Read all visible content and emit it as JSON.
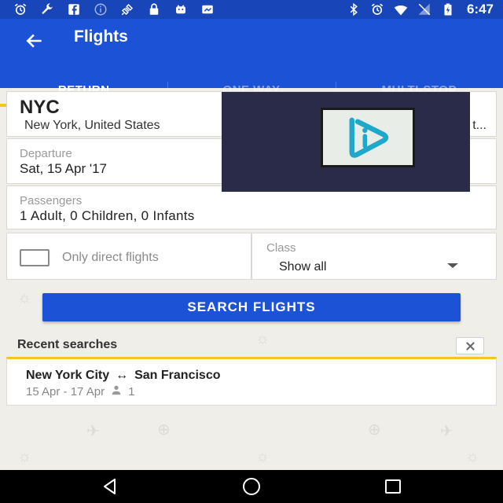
{
  "status": {
    "time": "6:47",
    "left_icons": [
      "alarm-icon",
      "wrench-icon",
      "facebook-icon",
      "info-icon",
      "satellite-icon",
      "lock-icon",
      "android-icon",
      "chat-icon"
    ],
    "right_icons": [
      "bluetooth-icon",
      "alarm-icon",
      "wifi-icon",
      "signal-icon",
      "battery-icon"
    ]
  },
  "header": {
    "title": "Flights"
  },
  "tabs": [
    {
      "label": "RETURN",
      "active": true
    },
    {
      "label": "ONE WAY",
      "active": false
    },
    {
      "label": "MULTI-STOP",
      "active": false
    }
  ],
  "origin": {
    "code": "NYC",
    "city": "New York, United States",
    "dest_truncated": "t..."
  },
  "departure": {
    "label": "Departure",
    "value": "Sat, 15 Apr '17"
  },
  "passengers": {
    "label": "Passengers",
    "value": "1 Adult, 0 Children, 0 Infants"
  },
  "options": {
    "direct_label": "Only direct flights",
    "class_label": "Class",
    "class_value": "Show all"
  },
  "search": {
    "button_label": "SEARCH FLIGHTS"
  },
  "recent": {
    "title": "Recent searches",
    "items": [
      {
        "from": "New York City",
        "arrow": "↔",
        "to": "San Francisco",
        "dates": "15 Apr - 17 Apr",
        "passengers": "1"
      }
    ]
  },
  "colors": {
    "primary": "#1c52d6",
    "accent": "#f6c426",
    "statusbar": "#1846b9"
  }
}
